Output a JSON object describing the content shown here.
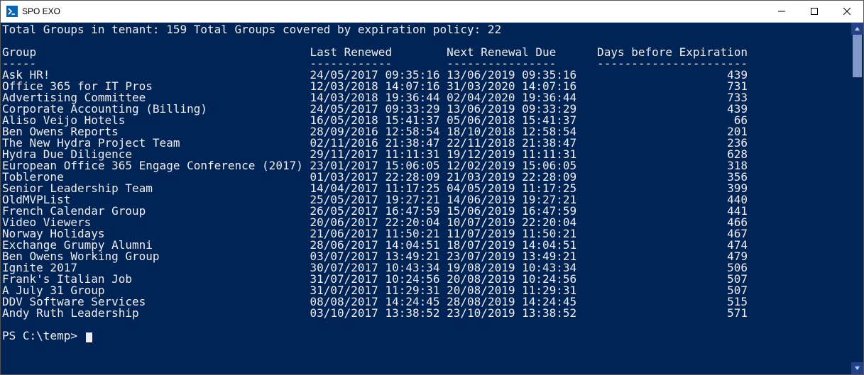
{
  "window": {
    "title": "SPO EXO"
  },
  "summary": {
    "total_groups": 159,
    "covered_by_policy": 22
  },
  "summary_line": "Total Groups in tenant: 159 Total Groups covered by expiration policy: 22",
  "columns": {
    "group": "Group",
    "last_renewed": "Last Renewed",
    "next_renewal": "Next Renewal Due",
    "days_before": "Days before Expiration"
  },
  "data": [
    {
      "group": "Ask HR!",
      "last_renewed": "24/05/2017 09:35:16",
      "next_renewal": "13/06/2019 09:35:16",
      "days": 439
    },
    {
      "group": "Office 365 for IT Pros",
      "last_renewed": "12/03/2018 14:07:16",
      "next_renewal": "31/03/2020 14:07:16",
      "days": 731
    },
    {
      "group": "Advertising Committee",
      "last_renewed": "14/03/2018 19:36:44",
      "next_renewal": "02/04/2020 19:36:44",
      "days": 733
    },
    {
      "group": "Corporate Accounting (Billing)",
      "last_renewed": "24/05/2017 09:33:29",
      "next_renewal": "13/06/2019 09:33:29",
      "days": 439
    },
    {
      "group": "Aliso Veijo Hotels",
      "last_renewed": "16/05/2018 15:41:37",
      "next_renewal": "05/06/2018 15:41:37",
      "days": 66
    },
    {
      "group": "Ben Owens Reports",
      "last_renewed": "28/09/2016 12:58:54",
      "next_renewal": "18/10/2018 12:58:54",
      "days": 201
    },
    {
      "group": "The New Hydra Project Team",
      "last_renewed": "02/11/2016 21:38:47",
      "next_renewal": "22/11/2018 21:38:47",
      "days": 236
    },
    {
      "group": "Hydra Due Diligence",
      "last_renewed": "29/11/2017 11:11:31",
      "next_renewal": "19/12/2019 11:11:31",
      "days": 628
    },
    {
      "group": "European Office 365 Engage Conference (2017)",
      "last_renewed": "23/01/2017 15:06:05",
      "next_renewal": "12/02/2019 15:06:05",
      "days": 318
    },
    {
      "group": "Toblerone",
      "last_renewed": "01/03/2017 22:28:09",
      "next_renewal": "21/03/2019 22:28:09",
      "days": 356
    },
    {
      "group": "Senior Leadership Team",
      "last_renewed": "14/04/2017 11:17:25",
      "next_renewal": "04/05/2019 11:17:25",
      "days": 399
    },
    {
      "group": "OldMVPList",
      "last_renewed": "25/05/2017 19:27:21",
      "next_renewal": "14/06/2019 19:27:21",
      "days": 440
    },
    {
      "group": "French Calendar Group",
      "last_renewed": "26/05/2017 16:47:59",
      "next_renewal": "15/06/2019 16:47:59",
      "days": 441
    },
    {
      "group": "Video Viewers",
      "last_renewed": "20/06/2017 22:20:04",
      "next_renewal": "10/07/2019 22:20:04",
      "days": 466
    },
    {
      "group": "Norway Holidays",
      "last_renewed": "21/06/2017 11:50:21",
      "next_renewal": "11/07/2019 11:50:21",
      "days": 467
    },
    {
      "group": "Exchange Grumpy Alumni",
      "last_renewed": "28/06/2017 14:04:51",
      "next_renewal": "18/07/2019 14:04:51",
      "days": 474
    },
    {
      "group": "Ben Owens Working Group",
      "last_renewed": "03/07/2017 13:49:21",
      "next_renewal": "23/07/2019 13:49:21",
      "days": 479
    },
    {
      "group": "Ignite 2017",
      "last_renewed": "30/07/2017 10:43:34",
      "next_renewal": "19/08/2019 10:43:34",
      "days": 506
    },
    {
      "group": "Frank's Italian Job",
      "last_renewed": "31/07/2017 10:24:56",
      "next_renewal": "20/08/2019 10:24:56",
      "days": 507
    },
    {
      "group": "A July 31 Group",
      "last_renewed": "31/07/2017 11:29:31",
      "next_renewal": "20/08/2019 11:29:31",
      "days": 507
    },
    {
      "group": "DDV Software Services",
      "last_renewed": "08/08/2017 14:24:45",
      "next_renewal": "28/08/2019 14:24:45",
      "days": 515
    },
    {
      "group": "Andy Ruth Leadership",
      "last_renewed": "03/10/2017 13:38:52",
      "next_renewal": "23/10/2019 13:38:52",
      "days": 571
    }
  ],
  "prompt": "PS C:\\temp>",
  "layout": {
    "col_group": 45,
    "col_last": 20,
    "col_next": 20,
    "col_days": 24
  }
}
